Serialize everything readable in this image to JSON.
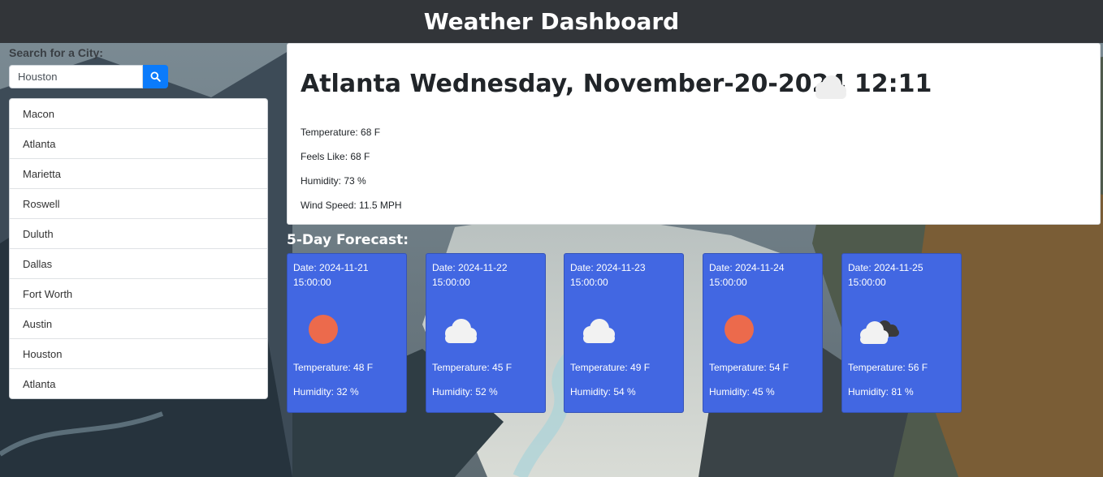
{
  "header": {
    "title": "Weather Dashboard"
  },
  "search": {
    "label": "Search for a City:",
    "value": "Houston"
  },
  "history": [
    "Macon",
    "Atlanta",
    "Marietta",
    "Roswell",
    "Duluth",
    "Dallas",
    "Fort Worth",
    "Austin",
    "Houston",
    "Atlanta"
  ],
  "current": {
    "title": "Atlanta Wednesday, November-20-2024 12:11",
    "icon": "cloud-icon",
    "temperature": "Temperature: 68 F",
    "feels_like": "Feels Like: 68 F",
    "humidity": "Humidity: 73 %",
    "wind": "Wind Speed: 11.5 MPH"
  },
  "forecast": {
    "heading": "5-Day Forecast:",
    "days": [
      {
        "date": "Date: 2024-11-21 15:00:00",
        "icon": "sun-icon",
        "temp": "Temperature: 48 F",
        "humidity": "Humidity: 32 %"
      },
      {
        "date": "Date: 2024-11-22 15:00:00",
        "icon": "cloud-icon",
        "temp": "Temperature: 45 F",
        "humidity": "Humidity: 52 %"
      },
      {
        "date": "Date: 2024-11-23 15:00:00",
        "icon": "cloud-icon",
        "temp": "Temperature: 49 F",
        "humidity": "Humidity: 54 %"
      },
      {
        "date": "Date: 2024-11-24 15:00:00",
        "icon": "sun-icon",
        "temp": "Temperature: 54 F",
        "humidity": "Humidity: 45 %"
      },
      {
        "date": "Date: 2024-11-25 15:00:00",
        "icon": "broken-clouds-icon",
        "temp": "Temperature: 56 F",
        "humidity": "Humidity: 81 %"
      }
    ]
  },
  "colors": {
    "header_bg": "#323539",
    "card_bg": "#4267e2",
    "search_button": "#0b7bfb",
    "sun": "#ec6a4c"
  }
}
